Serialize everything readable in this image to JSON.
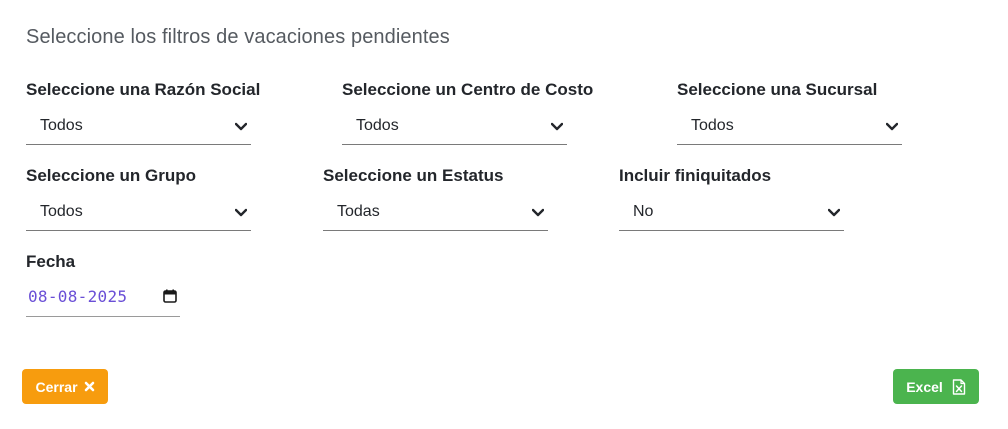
{
  "page": {
    "title": "Seleccione los filtros de vacaciones pendientes"
  },
  "filters": {
    "razon_social": {
      "label": "Seleccione una Razón Social",
      "value": "Todos"
    },
    "centro_costo": {
      "label": "Seleccione un Centro de Costo",
      "value": "Todos"
    },
    "sucursal": {
      "label": "Seleccione una Sucursal",
      "value": "Todos"
    },
    "grupo": {
      "label": "Seleccione un Grupo",
      "value": "Todos"
    },
    "estatus": {
      "label": "Seleccione un Estatus",
      "value": "Todas"
    },
    "finiquitados": {
      "label": "Incluir finiquitados",
      "value": "No"
    },
    "fecha": {
      "label": "Fecha",
      "value": "08-08-2025"
    }
  },
  "buttons": {
    "close_label": "Cerrar",
    "close_icon": "times-icon",
    "excel_label": "Excel",
    "excel_icon": "file-excel-icon"
  },
  "colors": {
    "close_button": "#f79c0e",
    "excel_button": "#4bb44e",
    "date_text": "#6a4fd6"
  }
}
